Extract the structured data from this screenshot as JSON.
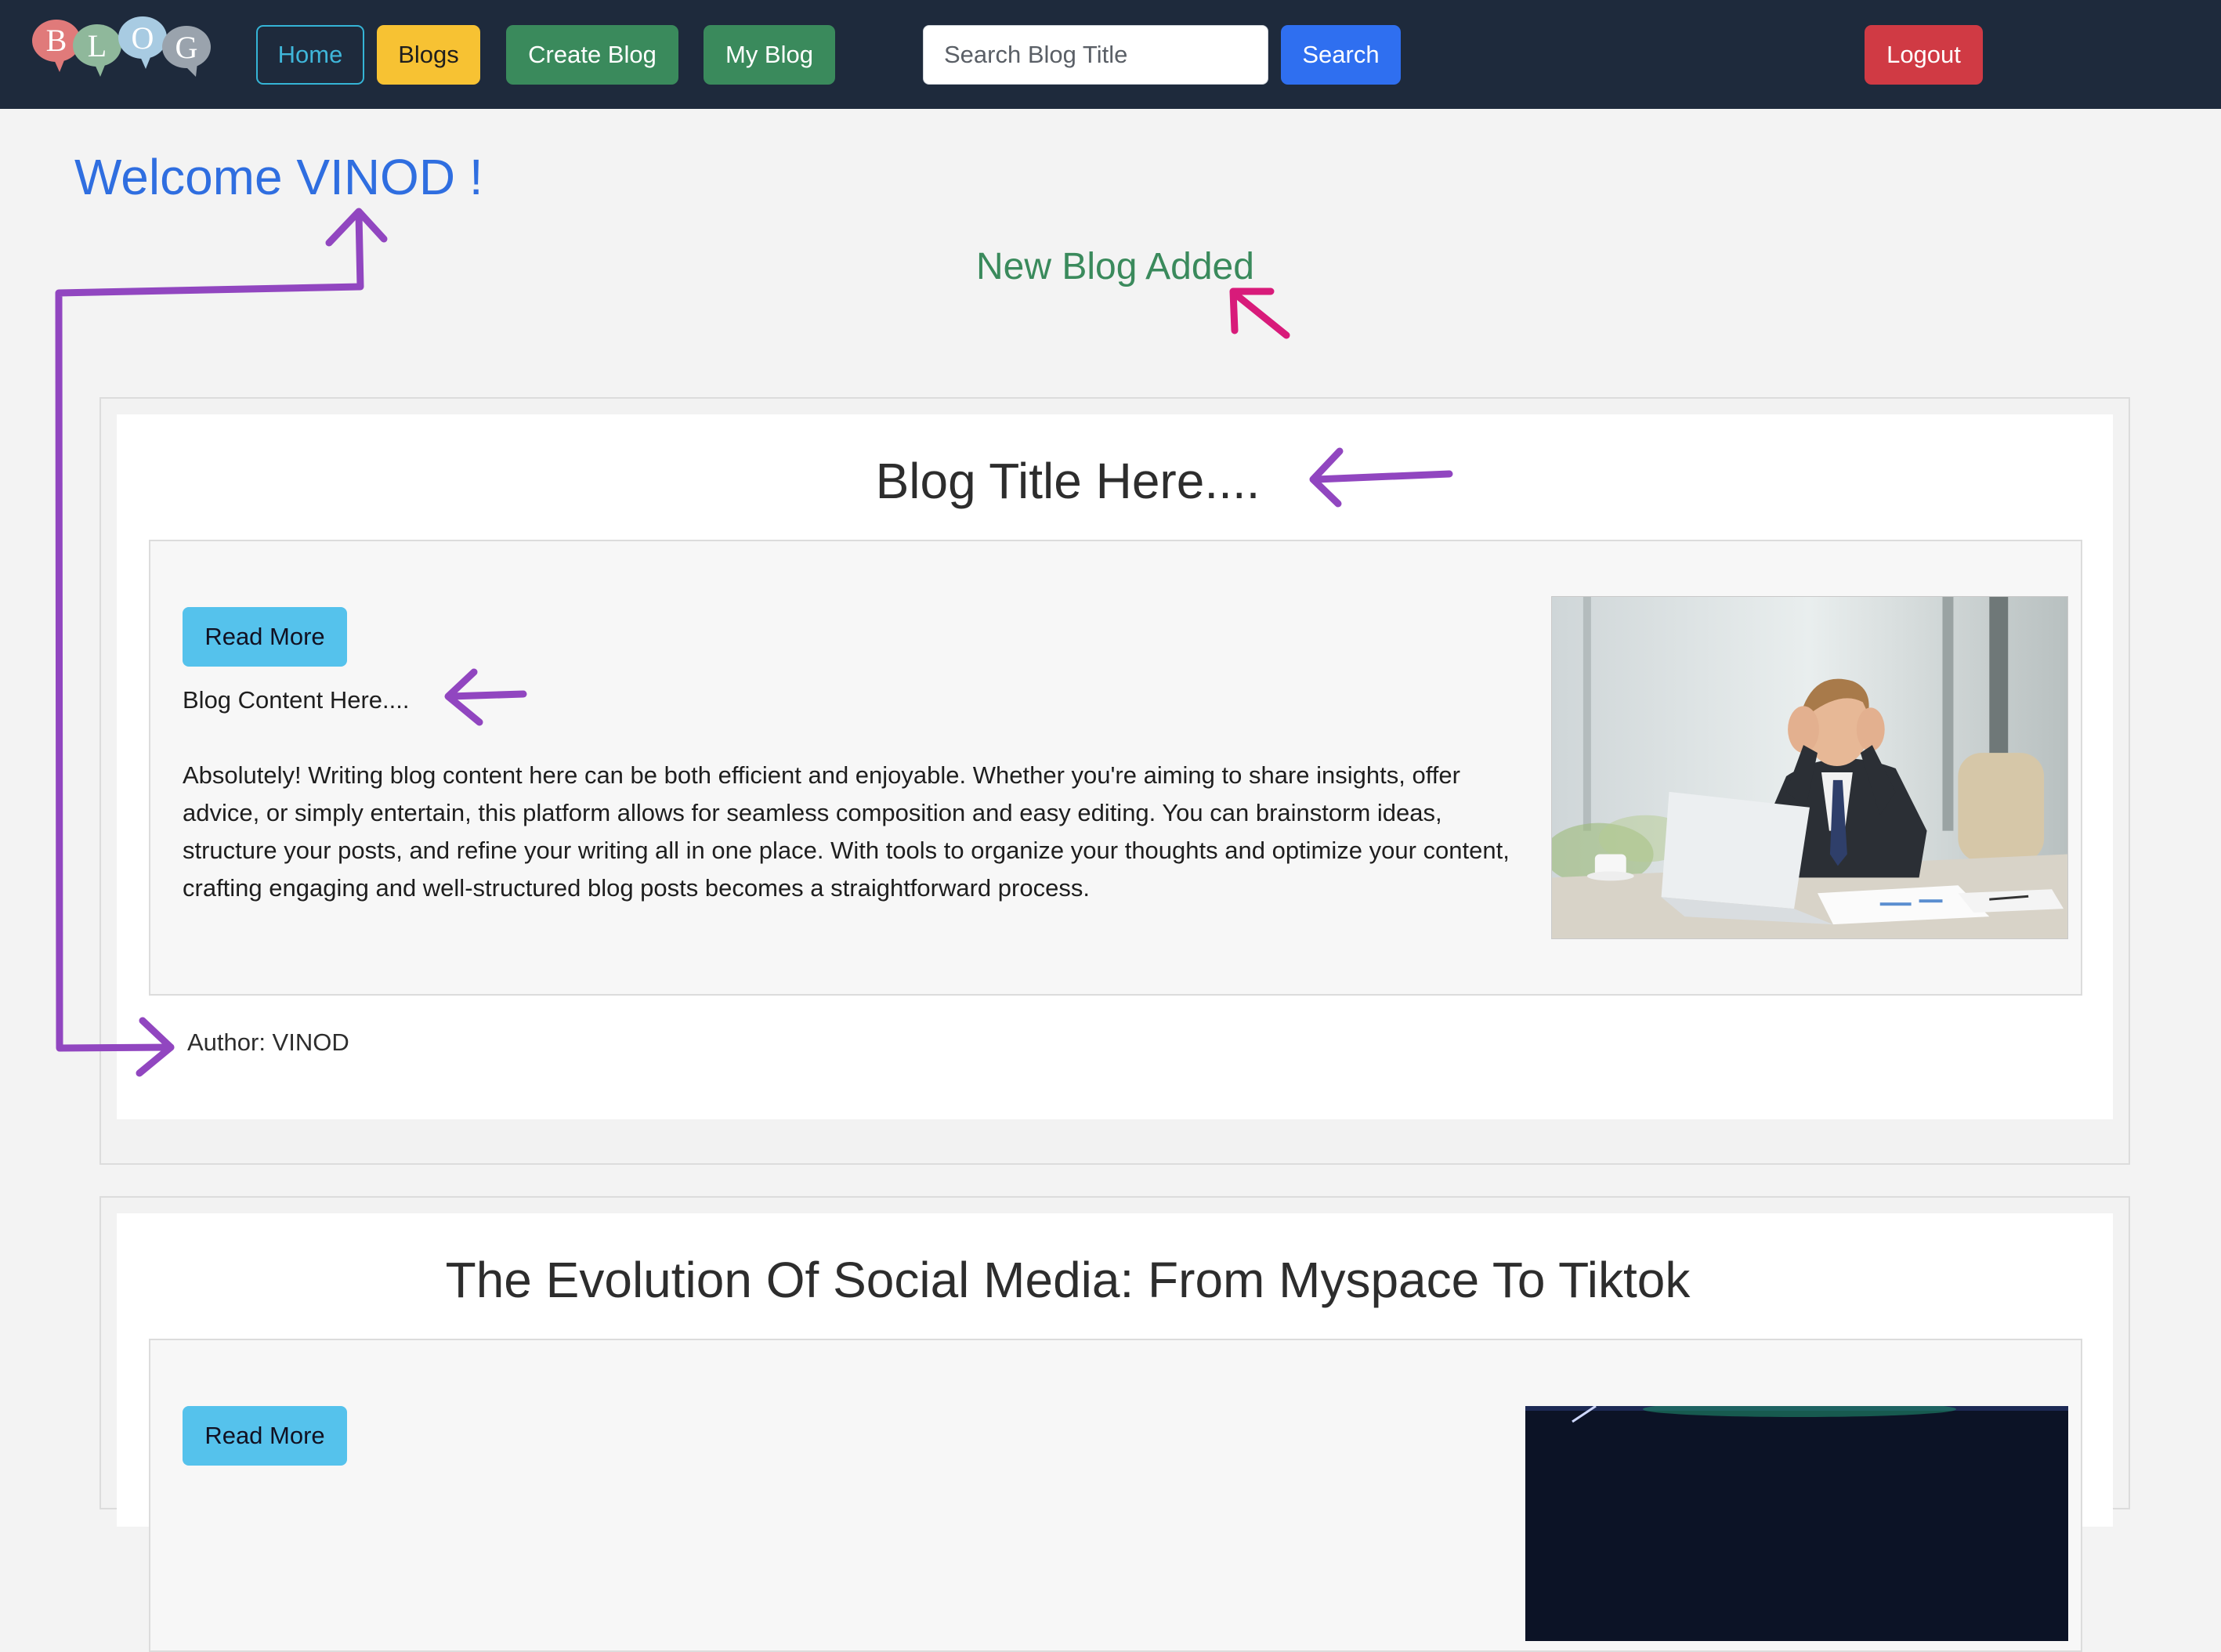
{
  "navbar": {
    "logo_letters": [
      "B",
      "L",
      "O",
      "G"
    ],
    "home_label": "Home",
    "blogs_label": "Blogs",
    "create_label": "Create Blog",
    "myblog_label": "My Blog",
    "search_placeholder": "Search Blog Title",
    "search_label": "Search",
    "logout_label": "Logout"
  },
  "welcome": "Welcome VINOD !",
  "notice": "New Blog Added",
  "posts": [
    {
      "title": "Blog Title Here....",
      "read_more_label": "Read More",
      "content_heading": "Blog Content Here....",
      "content_body": "Absolutely! Writing blog content here can be both efficient and enjoyable. Whether you're aiming to share insights, offer advice, or simply entertain, this platform allows for seamless composition and easy editing. You can brainstorm ideas, structure your posts, and refine your writing all in one place. With tools to organize your thoughts and optimize your content, crafting engaging and well-structured blog posts becomes a straightforward process.",
      "author": "Author: VINOD"
    },
    {
      "title": "The Evolution Of Social Media: From Myspace To Tiktok",
      "read_more_label": "Read More"
    }
  ],
  "colors": {
    "navbar_bg": "#1e2a3c",
    "welcome": "#2f6ee0",
    "notice": "#3a8a5c",
    "annotation_purple": "#9146c0",
    "annotation_pink": "#d81b7a"
  }
}
